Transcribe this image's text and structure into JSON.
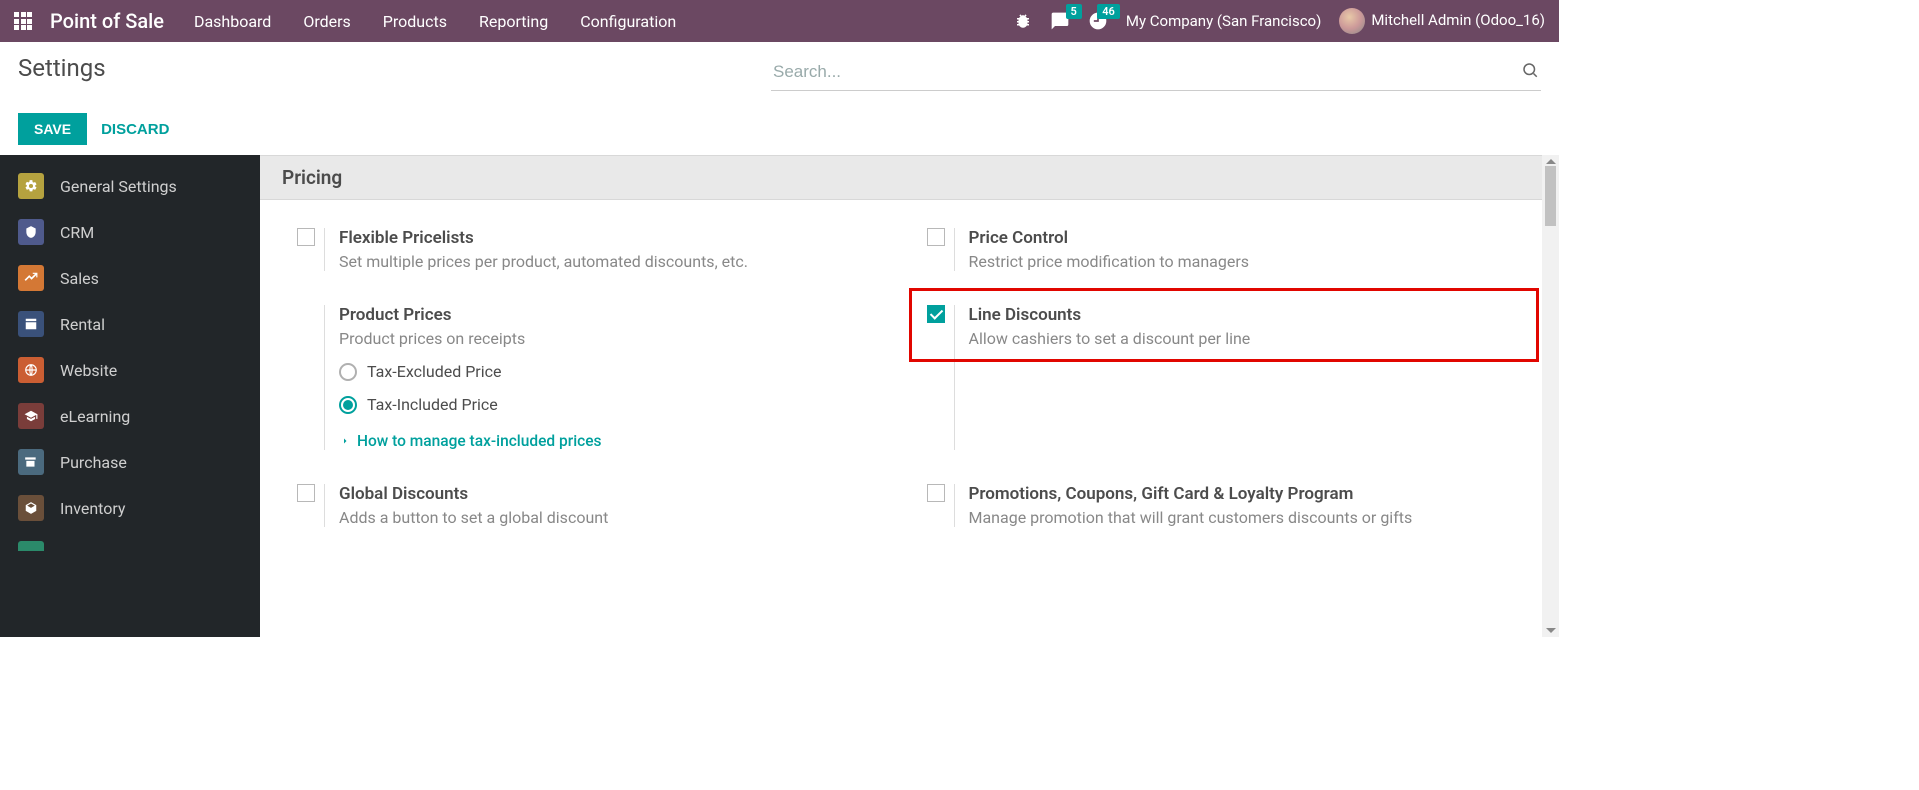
{
  "brand": "Point of Sale",
  "nav": {
    "items": [
      "Dashboard",
      "Orders",
      "Products",
      "Reporting",
      "Configuration"
    ]
  },
  "badges": {
    "messages": "5",
    "activities": "46"
  },
  "company": "My Company (San Francisco)",
  "user": "Mitchell Admin (Odoo_16)",
  "page_title": "Settings",
  "search": {
    "placeholder": "Search..."
  },
  "buttons": {
    "save": "SAVE",
    "discard": "DISCARD"
  },
  "sidebar": {
    "items": [
      {
        "label": "General Settings"
      },
      {
        "label": "CRM"
      },
      {
        "label": "Sales"
      },
      {
        "label": "Rental"
      },
      {
        "label": "Website"
      },
      {
        "label": "eLearning"
      },
      {
        "label": "Purchase"
      },
      {
        "label": "Inventory"
      }
    ]
  },
  "section": "Pricing",
  "settings": {
    "flex_pricelists": {
      "title": "Flexible Pricelists",
      "desc": "Set multiple prices per product, automated discounts, etc.",
      "checked": false
    },
    "price_control": {
      "title": "Price Control",
      "desc": "Restrict price modification to managers",
      "checked": false
    },
    "product_prices": {
      "title": "Product Prices",
      "desc": "Product prices on receipts"
    },
    "radios": {
      "excluded": "Tax-Excluded Price",
      "included": "Tax-Included Price",
      "selected": "included"
    },
    "tax_link": "How to manage tax-included prices",
    "line_discounts": {
      "title": "Line Discounts",
      "desc": "Allow cashiers to set a discount per line",
      "checked": true
    },
    "global_discounts": {
      "title": "Global Discounts",
      "desc": "Adds a button to set a global discount",
      "checked": false
    },
    "promotions": {
      "title": "Promotions, Coupons, Gift Card & Loyalty Program",
      "desc": "Manage promotion that will grant customers discounts or gifts",
      "checked": false
    }
  }
}
